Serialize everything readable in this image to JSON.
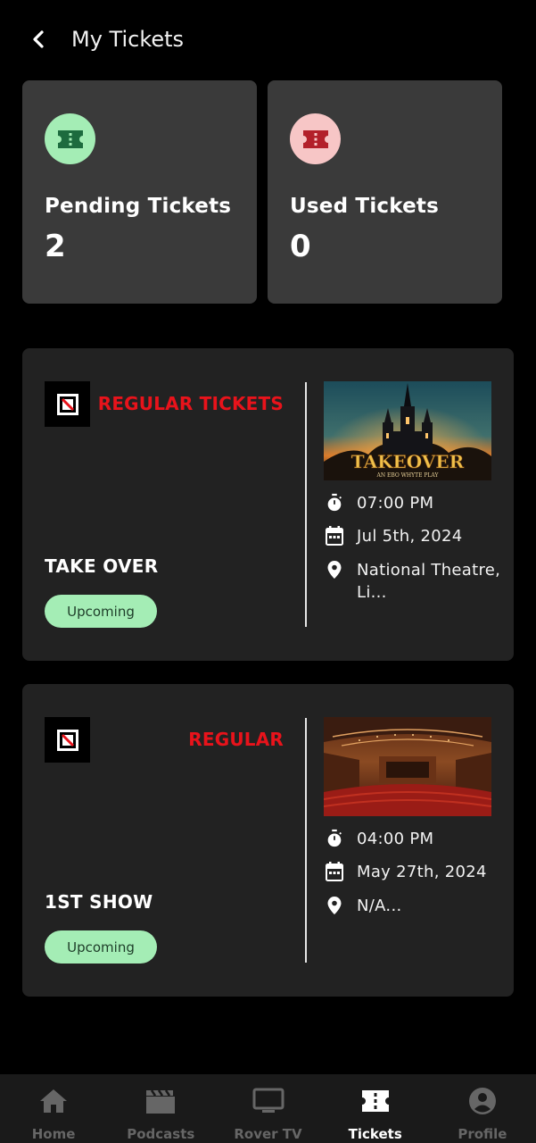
{
  "header": {
    "title": "My Tickets",
    "back_icon": "chevron-left-icon"
  },
  "stats": {
    "pending": {
      "label": "Pending Tickets",
      "count": "2",
      "icon": "ticket-icon",
      "color": "#1d6b3e",
      "bg": "#a4edb5"
    },
    "used": {
      "label": "Used Tickets",
      "count": "0",
      "icon": "ticket-icon",
      "color": "#b3202a",
      "bg": "#f7c6c6"
    }
  },
  "tickets": [
    {
      "type": "REGULAR TICKETS",
      "event_name": "TAKE OVER",
      "status": "Upcoming",
      "poster_title": "TAKEOVER",
      "poster_subtitle": "AN EBO WHYTE PLAY",
      "time": "07:00 PM",
      "date": "Jul 5th, 2024",
      "location": "National Theatre, Li..."
    },
    {
      "type": "REGULAR",
      "event_name": "1ST SHOW",
      "status": "Upcoming",
      "time": "04:00 PM",
      "date": "May 27th, 2024",
      "location": "N/A..."
    }
  ],
  "nav": {
    "items": [
      {
        "label": "Home",
        "icon": "home-icon"
      },
      {
        "label": "Podcasts",
        "icon": "clapperboard-icon"
      },
      {
        "label": "Rover TV",
        "icon": "tv-icon"
      },
      {
        "label": "Tickets",
        "icon": "ticket-icon",
        "active": true
      },
      {
        "label": "Profile",
        "icon": "profile-icon"
      }
    ]
  },
  "colors": {
    "accent_red": "#e8131b",
    "status_green": "#a4edb5",
    "card_bg": "#3a3a3a",
    "ticket_bg": "#222222"
  }
}
